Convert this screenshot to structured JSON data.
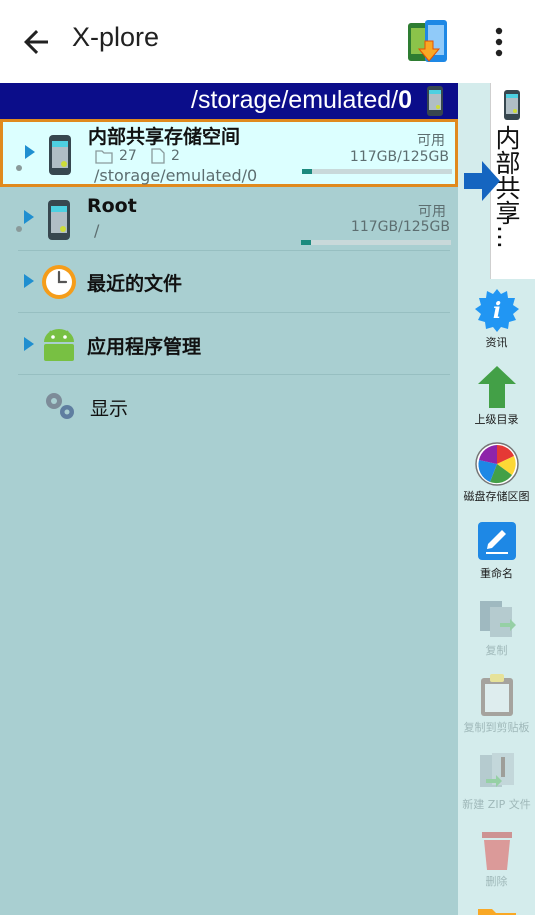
{
  "app": {
    "title": "X-plore"
  },
  "icons": {
    "back": "arrow-left-icon",
    "switch": "pane-switch-icon",
    "more": "more-vert-icon"
  },
  "colors": {
    "path_bar": "#0b0d8a",
    "selection_border": "#e08a1e",
    "panel_bg": "#a9cfd1",
    "progress": "#1c8a7e"
  },
  "path_bar": {
    "prefix": "/storage/emulated/",
    "current": "0"
  },
  "rows": [
    {
      "name": "内部共享存储空间",
      "folders": "27",
      "files": "2",
      "path": "/storage/emulated/0",
      "avail_label": "可用",
      "size": "117GB/125GB",
      "used_fraction": 0.064
    },
    {
      "name": "Root",
      "path": "/",
      "avail_label": "可用",
      "size": "117GB/125GB",
      "used_fraction": 0.064
    },
    {
      "name": "最近的文件"
    },
    {
      "name": "应用程序管理"
    },
    {
      "name": "显示"
    }
  ],
  "side_tab": {
    "label": "内部共享..."
  },
  "tools": [
    {
      "label": "资讯",
      "icon": "info-icon",
      "enabled": true
    },
    {
      "label": "上级目录",
      "icon": "parent-folder-arrow-icon",
      "enabled": true
    },
    {
      "label": "磁盘存储区图",
      "icon": "disk-map-icon",
      "enabled": true
    },
    {
      "label": "重命名",
      "icon": "rename-pencil-icon",
      "enabled": true
    },
    {
      "label": "复制",
      "icon": "copy-icon",
      "enabled": false
    },
    {
      "label": "复制到剪贴板",
      "icon": "clipboard-icon",
      "enabled": false
    },
    {
      "label": "新建 ZIP 文件",
      "icon": "zip-icon",
      "enabled": false
    },
    {
      "label": "删除",
      "icon": "trash-icon",
      "enabled": false
    }
  ]
}
